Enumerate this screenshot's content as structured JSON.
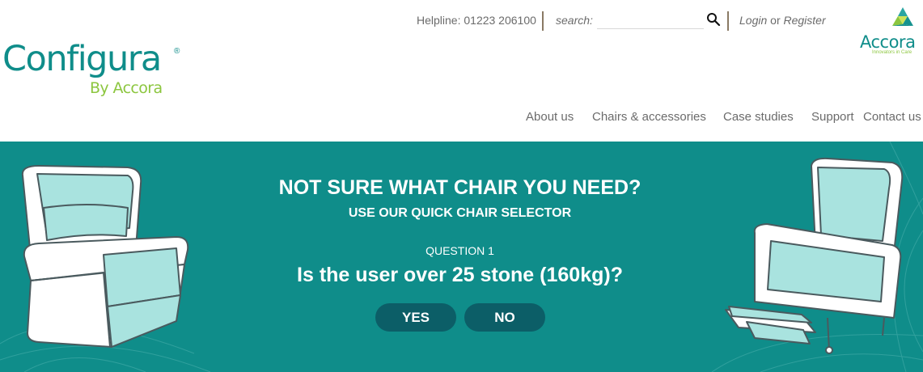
{
  "brand": {
    "logo_main": "Configura",
    "logo_reg": "®",
    "logo_sub": "By Accora",
    "partner_logo": "Accora",
    "partner_tagline": "Innovators in Care"
  },
  "utility": {
    "helpline": "Helpline: 01223 206100",
    "search_label": "search:",
    "search_value": "",
    "search_icon": "magnifier",
    "login_label": "Login",
    "or_text": "or",
    "register_label": "Register"
  },
  "nav": {
    "items": [
      "About us",
      "Chairs & accessories",
      "Case studies",
      "Support",
      "Contact us"
    ]
  },
  "hero": {
    "title": "NOT SURE WHAT CHAIR YOU NEED?",
    "subtitle": "USE OUR QUICK CHAIR SELECTOR",
    "question_label": "QUESTION 1",
    "question_text": "Is the user over 25 stone (160kg)?",
    "yes_label": "YES",
    "no_label": "NO"
  },
  "colors": {
    "teal": "#0f8d8a",
    "lime": "#8cc63f",
    "button": "#0c5e67",
    "chair_fill": "#a9e3df"
  }
}
